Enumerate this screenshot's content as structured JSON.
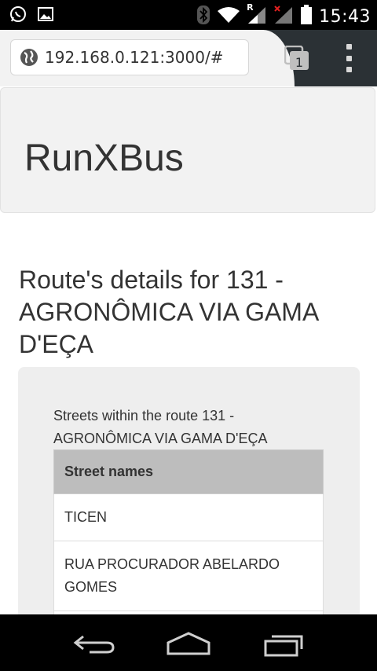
{
  "status_bar": {
    "time": "15:43",
    "network_label": "R"
  },
  "browser": {
    "url": "192.168.0.121:3000/#",
    "tab_count": "1"
  },
  "page": {
    "brand": "RunXBus",
    "route_title": "Route's details for 131 - AGRONÔMICA VIA GAMA D'EÇA",
    "streets_caption": "Streets within the route 131 - AGRONÔMICA VIA GAMA D'EÇA",
    "table": {
      "header": "Street names",
      "rows": [
        "TICEN",
        "RUA PROCURADOR ABELARDO GOMES",
        ""
      ]
    }
  }
}
